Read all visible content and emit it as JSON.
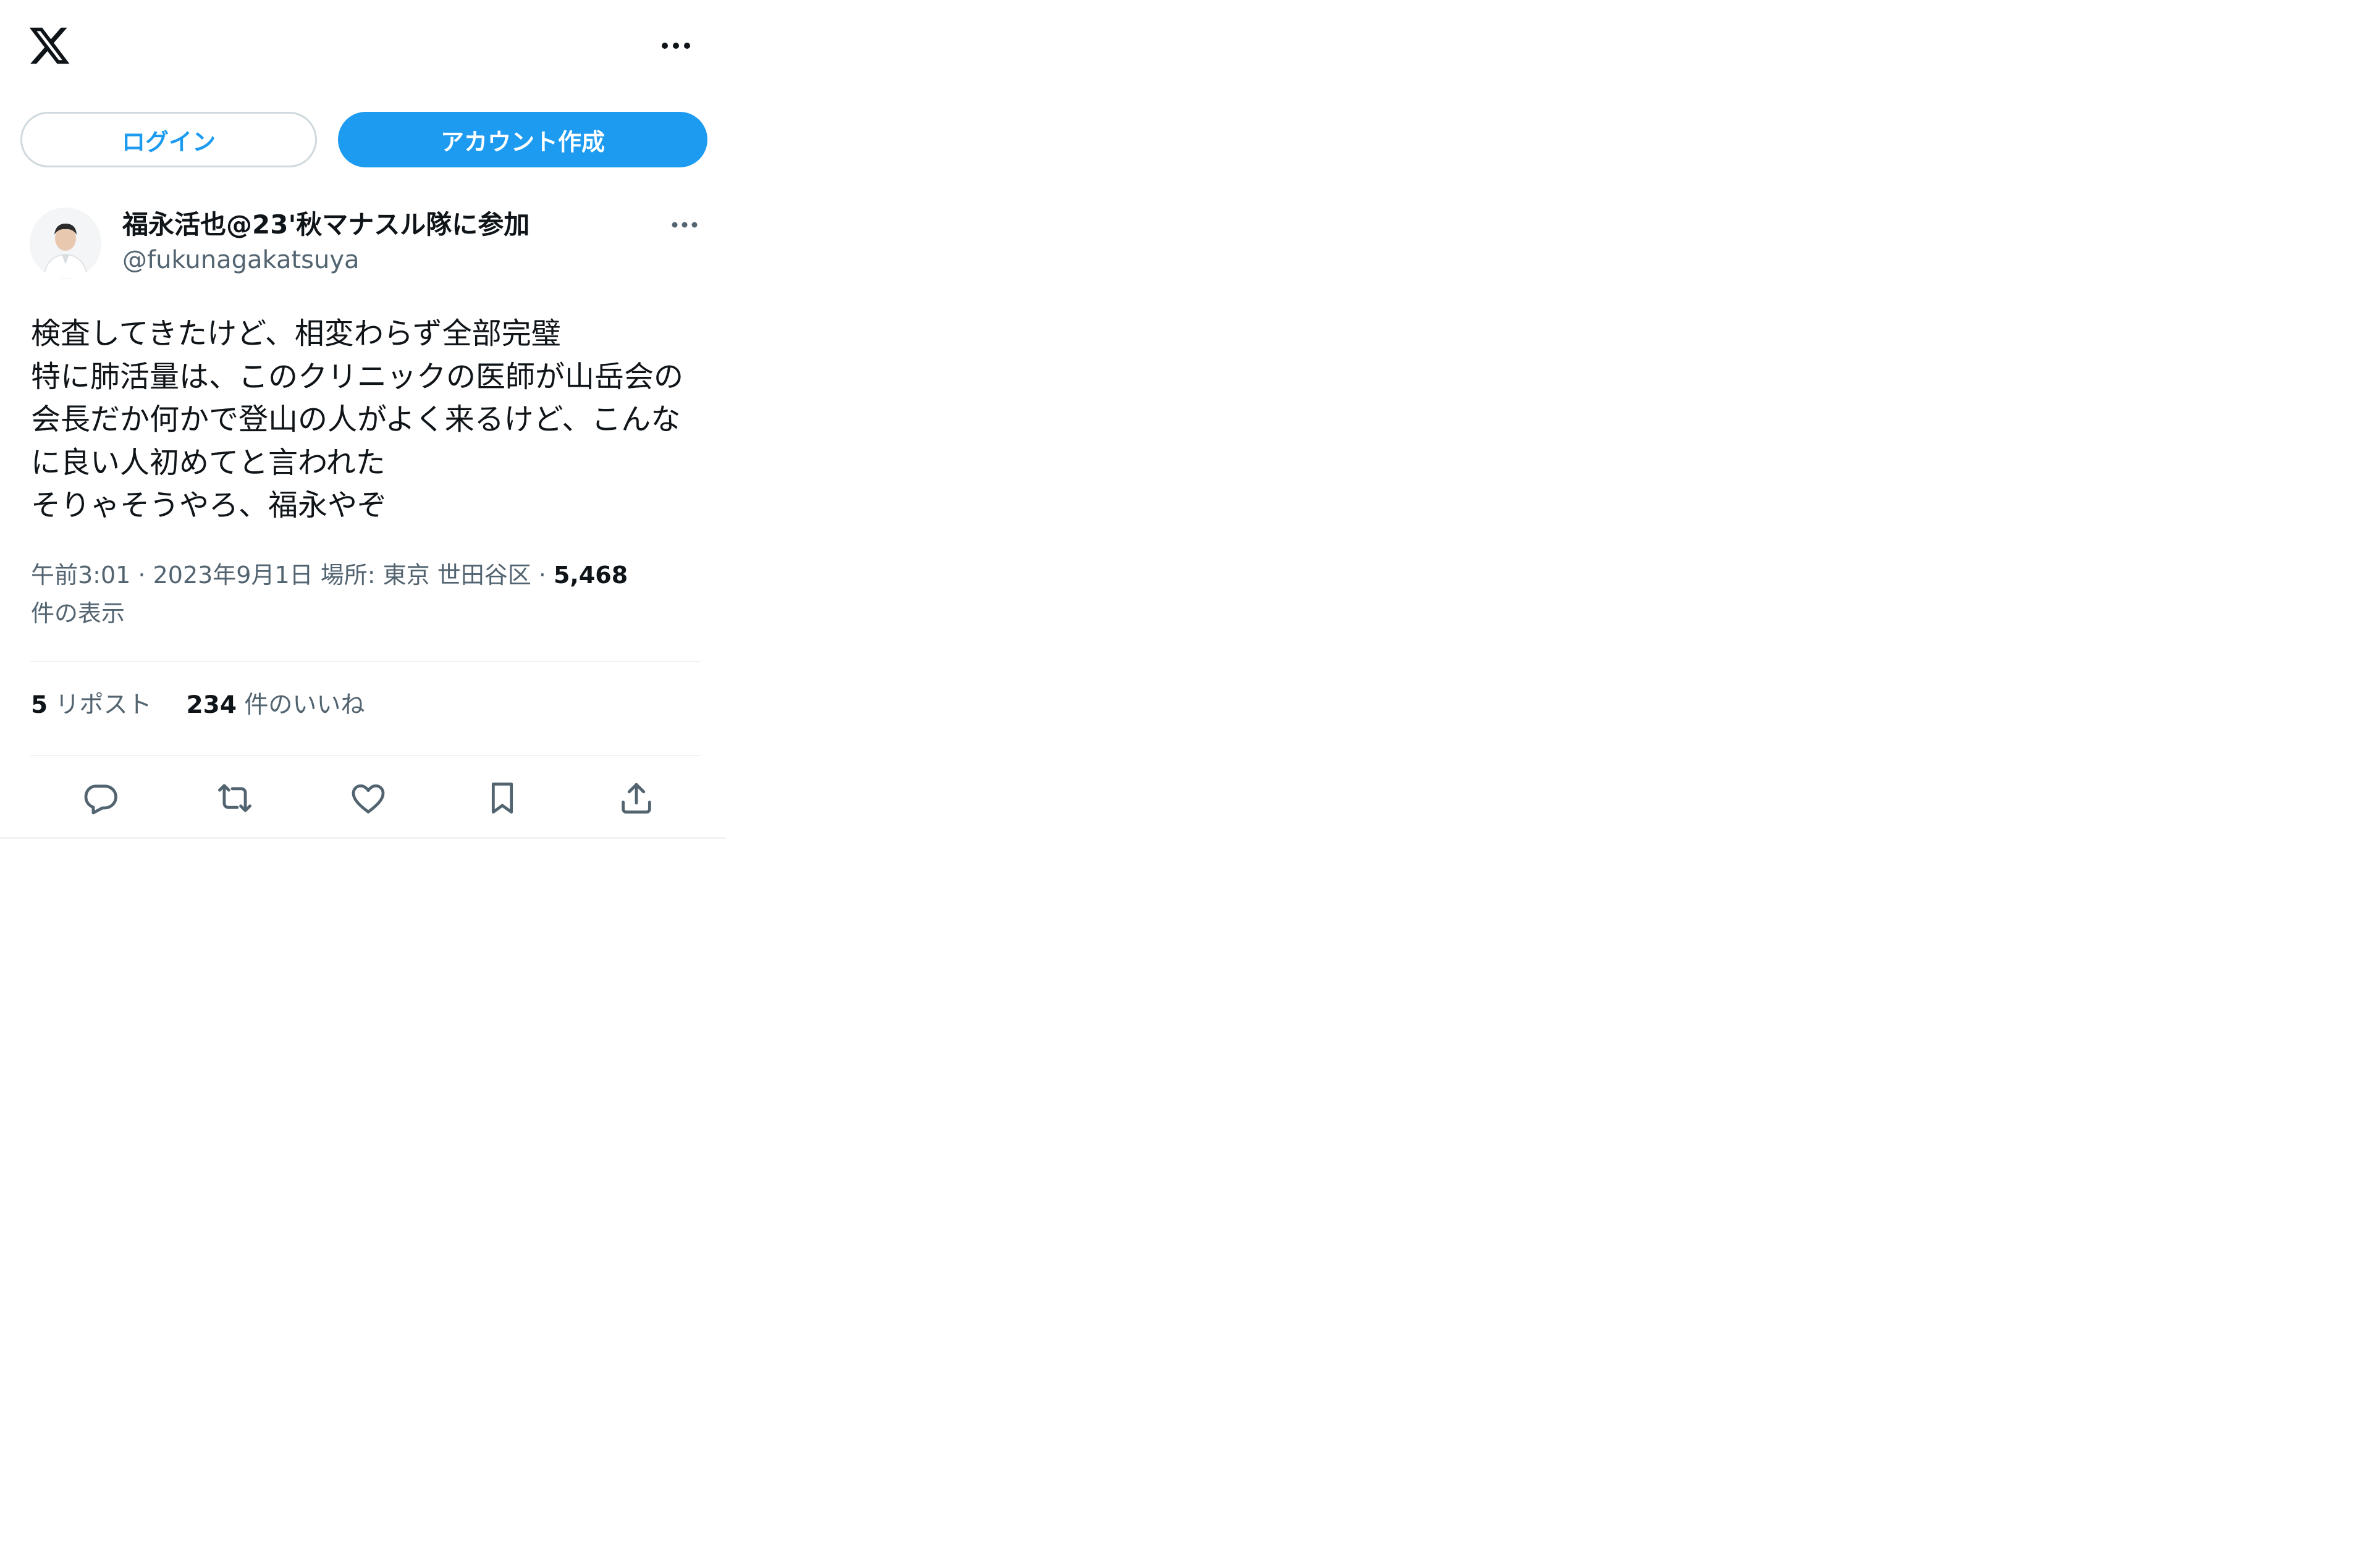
{
  "header": {
    "logo_icon": "x-logo-icon",
    "more_icon": "more-horizontal-icon"
  },
  "auth": {
    "login_label": "ログイン",
    "signup_label": "アカウント作成"
  },
  "tweet": {
    "author": {
      "display_name": "福永活也@23'秋マナスル隊に参加",
      "handle": "@fukunagakatsuya"
    },
    "text_lines": [
      "検査してきたけど、相変わらず全部完璧",
      "特に肺活量は、このクリニックの医師が山岳会の",
      "会長だか何かで登山の人がよく来るけど、こんな",
      "に良い人初めてと言われた",
      "そりゃそうやろ、福永やぞ"
    ],
    "meta": {
      "time": "午前3:01",
      "separator": " · ",
      "date": "2023年9月1日",
      "location": " 場所: 東京 世田谷区",
      "views_count": "5,468",
      "views_label": "件の表示"
    },
    "stats": {
      "reposts_count": "5",
      "reposts_label": " リポスト",
      "likes_count": "234",
      "likes_label": " 件のいいね"
    },
    "actions": [
      {
        "icon": "reply-icon"
      },
      {
        "icon": "repost-icon"
      },
      {
        "icon": "like-icon"
      },
      {
        "icon": "bookmark-icon"
      },
      {
        "icon": "share-icon"
      }
    ]
  },
  "colors": {
    "accent": "#1d9bf0",
    "text_primary": "#0f1419",
    "text_secondary": "#536471",
    "border": "#cfd9de",
    "divider": "#eff3f4"
  }
}
